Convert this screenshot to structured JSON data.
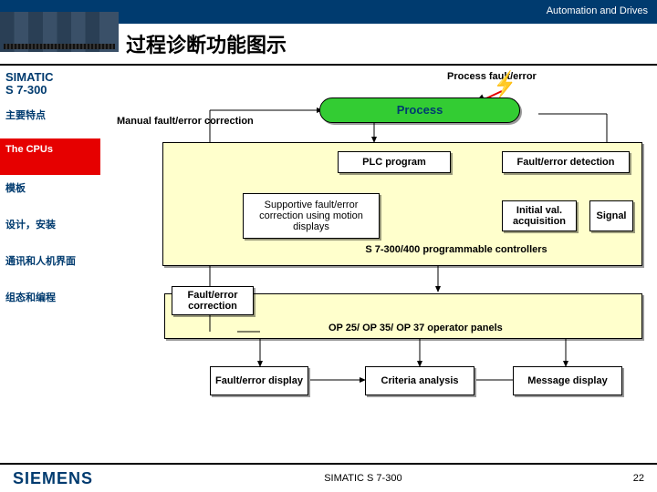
{
  "topbar": "Automation and Drives",
  "title": "过程诊断功能图示",
  "sidebar": {
    "product": "SIMATIC\nS 7-300",
    "items": [
      "主要特点",
      "The CPUs",
      "模板",
      "设计，安装",
      "通讯和人机界面",
      "组态和编程"
    ],
    "activeIndex": 1
  },
  "labels": {
    "pfe": "Process fault/error",
    "manual": "Manual fault/error correction",
    "process": "Process",
    "plc": "PLC program",
    "fed": "Fault/error detection",
    "support": "Supportive fault/error correction using motion displays",
    "iva": "Initial val. acquisition",
    "signal": "Signal",
    "s7": "S 7-300/400 programmable controllers",
    "fec": "Fault/error correction",
    "op": "OP 25/ OP 35/ OP 37 operator panels",
    "fedisp": "Fault/error display",
    "crit": "Criteria analysis",
    "msg": "Message display"
  },
  "footer": {
    "brand": "SIEMENS",
    "prod": "SIMATIC S 7-300",
    "page": "22"
  }
}
